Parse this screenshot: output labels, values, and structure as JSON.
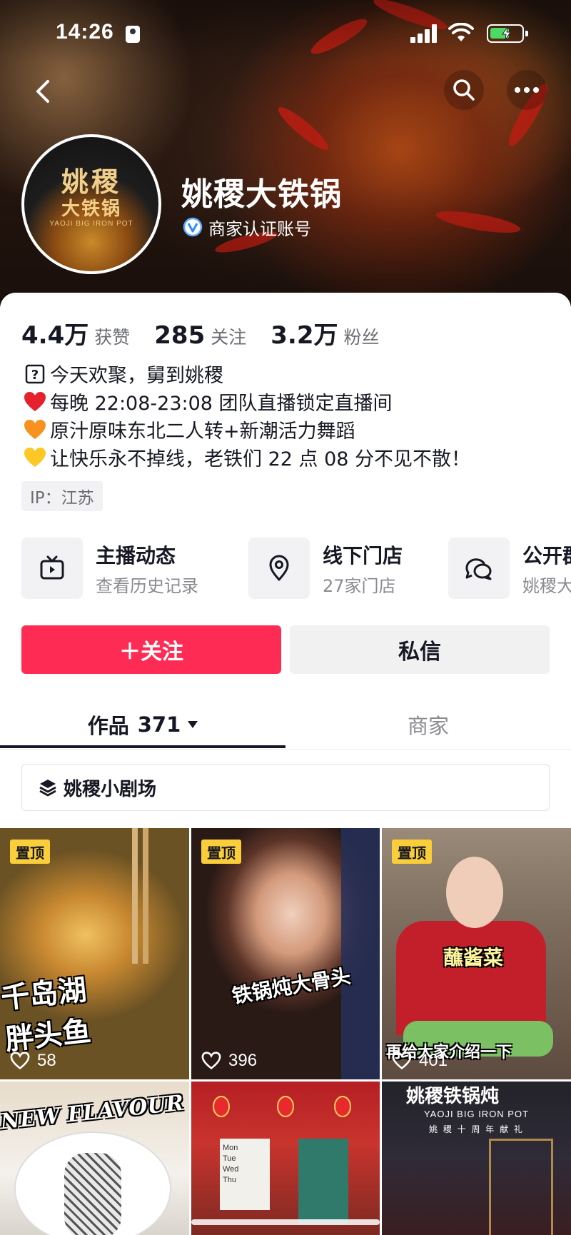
{
  "status_bar": {
    "time": "14:26"
  },
  "profile": {
    "name": "姚稷大铁锅",
    "verified_label": "商家认证账号",
    "avatar_title": "姚稷",
    "avatar_subtitle": "大铁锅",
    "avatar_english": "YAOJI BIG IRON POT"
  },
  "stats": [
    {
      "value": "4.4万",
      "label": "获赞"
    },
    {
      "value": "285",
      "label": "关注"
    },
    {
      "value": "3.2万",
      "label": "粉丝"
    }
  ],
  "bio": [
    {
      "icon": "question-box-icon",
      "text": "今天欢聚，舅到姚稷"
    },
    {
      "icon": "red-heart-icon",
      "text": "每晚 22:08-23:08 团队直播锁定直播间"
    },
    {
      "icon": "orange-heart-icon",
      "text": "原汁原味东北二人转+新潮活力舞蹈"
    },
    {
      "icon": "yellow-heart-icon",
      "text": "让快乐永不掉线，老铁们 22 点 08 分不见不散！"
    }
  ],
  "ip_location": "IP：江苏",
  "features": [
    {
      "icon": "live-tv-icon",
      "title": "主播动态",
      "subtitle": "查看历史记录"
    },
    {
      "icon": "location-pin-icon",
      "title": "线下门店",
      "subtitle": "27家门店"
    },
    {
      "icon": "group-chat-icon",
      "title": "公开群",
      "subtitle": "姚稷大"
    }
  ],
  "buttons": {
    "follow": "＋关注",
    "message": "私信"
  },
  "tabs": {
    "works_label": "作品",
    "works_count": "371",
    "shop_label": "商家"
  },
  "playlist_label": "姚稷小剧场",
  "grid": [
    {
      "pinned": "置顶",
      "likes": "58",
      "caption": "千岛湖\n胖头鱼"
    },
    {
      "pinned": "置顶",
      "likes": "396",
      "caption": "铁锅炖大骨头"
    },
    {
      "pinned": "置顶",
      "likes": "401",
      "caption": "蘸酱菜",
      "caption2": "再给大家介绍一下"
    },
    {
      "caption": "NEW FLAVOUR"
    },
    {
      "sign": "Mon\nTue\nWed\nThu"
    },
    {
      "caption": "姚稷铁锅炖",
      "caption2": "YAOJI BIG IRON POT",
      "caption3": "姚 稷 十 周 年 献 礼"
    }
  ],
  "colors": {
    "accent": "#fe2c55",
    "pin": "#facd3a",
    "text": "#161823",
    "muted": "#8a8b91"
  }
}
